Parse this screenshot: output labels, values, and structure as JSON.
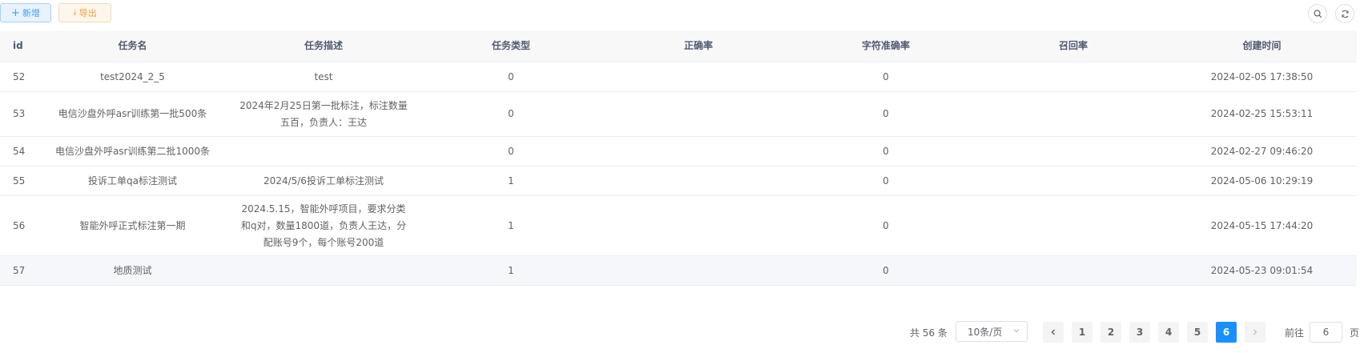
{
  "toolbar": {
    "add_label": "新增",
    "export_label": "导出",
    "search_icon": "search-icon",
    "refresh_icon": "refresh-icon"
  },
  "table": {
    "columns": [
      "id",
      "任务名",
      "任务描述",
      "任务类型",
      "正确率",
      "字符准确率",
      "召回率",
      "创建时间"
    ],
    "rows": [
      {
        "id": "52",
        "name": "test2024_2_5",
        "desc": [
          "test"
        ],
        "type": "0",
        "accuracy": "",
        "char_accuracy": "0",
        "recall": "",
        "created": "2024-02-05 17:38:50"
      },
      {
        "id": "53",
        "name": "电信沙盘外呼asr训练第一批500条",
        "desc": [
          "2024年2月25日第一批标注，标注数量",
          "五百，负责人：王达"
        ],
        "type": "0",
        "accuracy": "",
        "char_accuracy": "0",
        "recall": "",
        "created": "2024-02-25 15:53:11"
      },
      {
        "id": "54",
        "name": "电信沙盘外呼asr训练第二批1000条",
        "desc": [],
        "type": "0",
        "accuracy": "",
        "char_accuracy": "0",
        "recall": "",
        "created": "2024-02-27 09:46:20"
      },
      {
        "id": "55",
        "name": "投诉工单qa标注测试",
        "desc": [
          "2024/5/6投诉工单标注测试"
        ],
        "type": "1",
        "accuracy": "",
        "char_accuracy": "0",
        "recall": "",
        "created": "2024-05-06 10:29:19"
      },
      {
        "id": "56",
        "name": "智能外呼正式标注第一期",
        "desc": [
          "2024.5.15，智能外呼项目，要求分类",
          "和q对，数量1800道，负责人王达，分",
          "配账号9个，每个账号200道"
        ],
        "type": "1",
        "accuracy": "",
        "char_accuracy": "0",
        "recall": "",
        "created": "2024-05-15 17:44:20"
      },
      {
        "id": "57",
        "name": "地质测试",
        "desc": [],
        "type": "1",
        "accuracy": "",
        "char_accuracy": "0",
        "recall": "",
        "created": "2024-05-23 09:01:54"
      }
    ]
  },
  "pagination": {
    "total_text": "共 56 条",
    "page_size": "10条/页",
    "pages": [
      "1",
      "2",
      "3",
      "4",
      "5",
      "6"
    ],
    "current_page": "6",
    "goto_label": "前往",
    "goto_value": "6",
    "goto_unit": "页"
  },
  "colors": {
    "primary": "#1890ff",
    "add_button": "#409eff",
    "export_button": "#e6a23c"
  }
}
